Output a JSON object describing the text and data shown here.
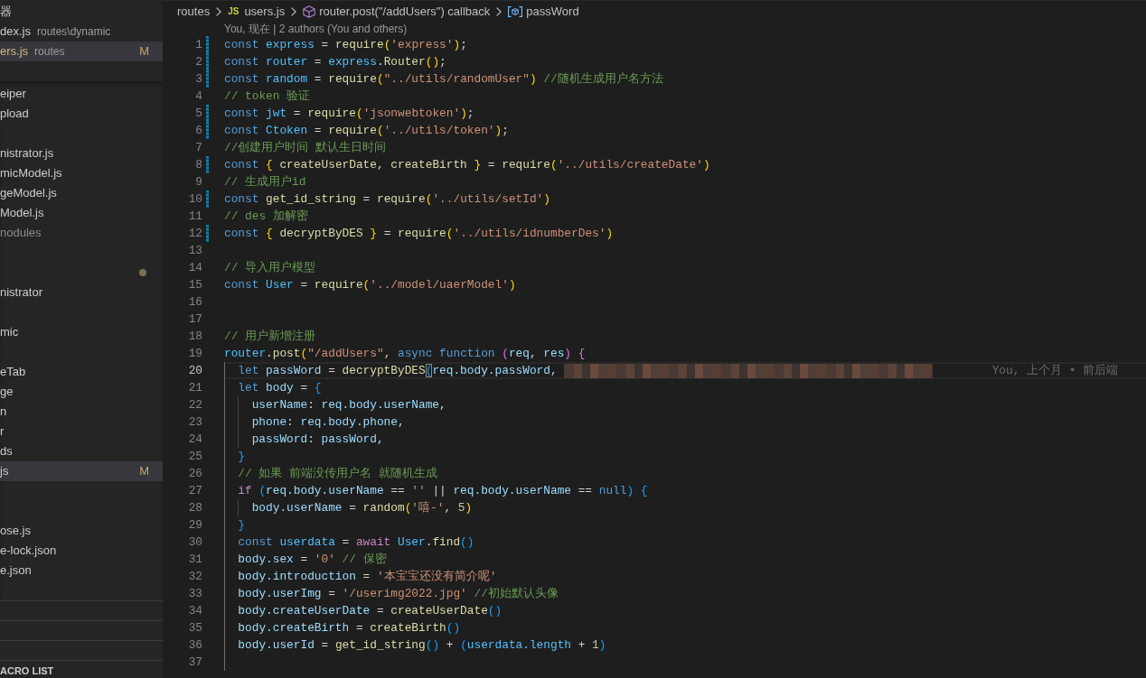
{
  "explorer": {
    "section_title": "器",
    "open_editors": [
      {
        "label": "dex.js",
        "description": "routes\\dynamic",
        "modified": false,
        "selected": false
      },
      {
        "label": "ers.js",
        "description": "routes",
        "badge": "M",
        "modified": true,
        "selected": true
      }
    ],
    "tree": [
      {
        "kind": "entry",
        "label": "eiper",
        "modified": false,
        "ignored": false,
        "selected": false
      },
      {
        "kind": "entry",
        "label": "pload",
        "modified": false,
        "ignored": false,
        "selected": false
      },
      {
        "kind": "entry",
        "label": "nistrator.js",
        "modified": false,
        "ignored": false,
        "selected": false
      },
      {
        "kind": "entry",
        "label": "micModel.js",
        "modified": false,
        "ignored": false,
        "selected": false
      },
      {
        "kind": "entry",
        "label": "geModel.js",
        "modified": false,
        "ignored": false,
        "selected": false
      },
      {
        "kind": "entry",
        "label": "Model.js",
        "modified": false,
        "ignored": false,
        "selected": false
      },
      {
        "kind": "entry",
        "label": "nodules",
        "modified": false,
        "ignored": true,
        "selected": false
      },
      {
        "kind": "dot",
        "modified": true,
        "ignored": false,
        "selected": false
      },
      {
        "kind": "entry",
        "label": "nistrator",
        "modified": false,
        "ignored": false,
        "selected": false
      },
      {
        "kind": "entry",
        "label": "mic",
        "modified": false,
        "ignored": false,
        "selected": false
      },
      {
        "kind": "entry",
        "label": "eTab",
        "modified": false,
        "ignored": false,
        "selected": false
      },
      {
        "kind": "entry",
        "label": "ge",
        "modified": false,
        "ignored": false,
        "selected": false
      },
      {
        "kind": "entry",
        "label": "n",
        "modified": false,
        "ignored": false,
        "selected": false
      },
      {
        "kind": "entry",
        "label": "r",
        "modified": false,
        "ignored": false,
        "selected": false
      },
      {
        "kind": "entry",
        "label": "ds",
        "modified": false,
        "ignored": false,
        "selected": false
      },
      {
        "kind": "entry",
        "label": "js",
        "badge": "M",
        "modified": false,
        "ignored": false,
        "selected": true
      },
      {
        "kind": "entry",
        "label": "ose.js",
        "modified": false,
        "ignored": false,
        "selected": false
      },
      {
        "kind": "entry",
        "label": "e-lock.json",
        "modified": false,
        "ignored": false,
        "selected": false
      },
      {
        "kind": "entry",
        "label": "e.json",
        "modified": false,
        "ignored": false,
        "selected": false
      }
    ],
    "bottom_panel_title": "ACRO LIST"
  },
  "editor": {
    "breadcrumb": [
      {
        "kind": "folder",
        "label": "routes"
      },
      {
        "kind": "file",
        "badge": "JS",
        "label": "users.js"
      },
      {
        "kind": "method",
        "label": "router.post(\"/addUsers\") callback"
      },
      {
        "kind": "variable",
        "label": "passWord"
      }
    ],
    "codelens": "You, 现在 | 2 authors (You and others)",
    "lines": [
      {
        "number": "1",
        "changed": true,
        "current": false,
        "tokens": [
          {
            "text": "const ",
            "kind": "keyword"
          },
          {
            "text": "express",
            "kind": "constant"
          },
          {
            "text": " = ",
            "kind": "plain"
          },
          {
            "text": "require",
            "kind": "function"
          },
          {
            "text": "(",
            "kind": "bracket1"
          },
          {
            "text": "'express'",
            "kind": "string"
          },
          {
            "text": ")",
            "kind": "bracket1"
          },
          {
            "text": ";",
            "kind": "plain"
          }
        ]
      },
      {
        "number": "2",
        "changed": true,
        "current": false,
        "tokens": [
          {
            "text": "const ",
            "kind": "keyword"
          },
          {
            "text": "router",
            "kind": "constant"
          },
          {
            "text": " = ",
            "kind": "plain"
          },
          {
            "text": "express",
            "kind": "constant"
          },
          {
            "text": ".",
            "kind": "plain"
          },
          {
            "text": "Router",
            "kind": "function"
          },
          {
            "text": "()",
            "kind": "bracket1"
          },
          {
            "text": ";",
            "kind": "plain"
          }
        ]
      },
      {
        "number": "3",
        "changed": true,
        "current": false,
        "tokens": [
          {
            "text": "const ",
            "kind": "keyword"
          },
          {
            "text": "random",
            "kind": "constant"
          },
          {
            "text": " = ",
            "kind": "plain"
          },
          {
            "text": "require",
            "kind": "function"
          },
          {
            "text": "(",
            "kind": "bracket1"
          },
          {
            "text": "\"../utils/randomUser\"",
            "kind": "string"
          },
          {
            "text": ")",
            "kind": "bracket1"
          },
          {
            "text": " //随机生成用户名方法",
            "kind": "comment"
          }
        ]
      },
      {
        "number": "4",
        "changed": false,
        "current": false,
        "tokens": [
          {
            "text": "// token 验证",
            "kind": "comment"
          }
        ]
      },
      {
        "number": "5",
        "changed": true,
        "current": false,
        "tokens": [
          {
            "text": "const ",
            "kind": "keyword"
          },
          {
            "text": "jwt",
            "kind": "constant"
          },
          {
            "text": " = ",
            "kind": "plain"
          },
          {
            "text": "require",
            "kind": "function"
          },
          {
            "text": "(",
            "kind": "bracket1"
          },
          {
            "text": "'jsonwebtoken'",
            "kind": "string"
          },
          {
            "text": ")",
            "kind": "bracket1"
          },
          {
            "text": ";",
            "kind": "plain"
          }
        ]
      },
      {
        "number": "6",
        "changed": true,
        "current": false,
        "tokens": [
          {
            "text": "const ",
            "kind": "keyword"
          },
          {
            "text": "Ctoken",
            "kind": "constant"
          },
          {
            "text": " = ",
            "kind": "plain"
          },
          {
            "text": "require",
            "kind": "function"
          },
          {
            "text": "(",
            "kind": "bracket1"
          },
          {
            "text": "'../utils/token'",
            "kind": "string"
          },
          {
            "text": ")",
            "kind": "bracket1"
          },
          {
            "text": ";",
            "kind": "plain"
          }
        ]
      },
      {
        "number": "7",
        "changed": false,
        "current": false,
        "tokens": [
          {
            "text": "//创建用户时间 默认生日时间",
            "kind": "comment"
          }
        ]
      },
      {
        "number": "8",
        "changed": true,
        "current": false,
        "tokens": [
          {
            "text": "const ",
            "kind": "keyword"
          },
          {
            "text": "{",
            "kind": "bracket1"
          },
          {
            "text": " createUserDate",
            "kind": "function"
          },
          {
            "text": ", ",
            "kind": "plain"
          },
          {
            "text": "createBirth ",
            "kind": "function"
          },
          {
            "text": "}",
            "kind": "bracket1"
          },
          {
            "text": " = ",
            "kind": "plain"
          },
          {
            "text": "require",
            "kind": "function"
          },
          {
            "text": "(",
            "kind": "bracket1"
          },
          {
            "text": "'../utils/createDate'",
            "kind": "string"
          },
          {
            "text": ")",
            "kind": "bracket1"
          }
        ]
      },
      {
        "number": "9",
        "changed": false,
        "current": false,
        "tokens": [
          {
            "text": "// 生成用户id",
            "kind": "comment"
          }
        ]
      },
      {
        "number": "10",
        "changed": true,
        "current": false,
        "tokens": [
          {
            "text": "const ",
            "kind": "keyword"
          },
          {
            "text": "get_id_string",
            "kind": "function"
          },
          {
            "text": " = ",
            "kind": "plain"
          },
          {
            "text": "require",
            "kind": "function"
          },
          {
            "text": "(",
            "kind": "bracket1"
          },
          {
            "text": "'../utils/setId'",
            "kind": "string"
          },
          {
            "text": ")",
            "kind": "bracket1"
          }
        ]
      },
      {
        "number": "11",
        "changed": false,
        "current": false,
        "tokens": [
          {
            "text": "// des 加解密",
            "kind": "comment"
          }
        ]
      },
      {
        "number": "12",
        "changed": true,
        "current": false,
        "tokens": [
          {
            "text": "const ",
            "kind": "keyword"
          },
          {
            "text": "{",
            "kind": "bracket1"
          },
          {
            "text": " decryptByDES ",
            "kind": "function"
          },
          {
            "text": "}",
            "kind": "bracket1"
          },
          {
            "text": " = ",
            "kind": "plain"
          },
          {
            "text": "require",
            "kind": "function"
          },
          {
            "text": "(",
            "kind": "bracket1"
          },
          {
            "text": "'../utils/idnumberDes'",
            "kind": "string"
          },
          {
            "text": ")",
            "kind": "bracket1"
          }
        ]
      },
      {
        "number": "13",
        "changed": false,
        "current": false
      },
      {
        "number": "14",
        "changed": false,
        "current": false,
        "tokens": [
          {
            "text": "// 导入用户模型",
            "kind": "comment"
          }
        ]
      },
      {
        "number": "15",
        "changed": false,
        "current": false,
        "tokens": [
          {
            "text": "const ",
            "kind": "keyword"
          },
          {
            "text": "User",
            "kind": "constant"
          },
          {
            "text": " = ",
            "kind": "plain"
          },
          {
            "text": "require",
            "kind": "function"
          },
          {
            "text": "(",
            "kind": "bracket1"
          },
          {
            "text": "'../model/uaerModel'",
            "kind": "string"
          },
          {
            "text": ")",
            "kind": "bracket1"
          }
        ]
      },
      {
        "number": "16",
        "changed": false,
        "current": false
      },
      {
        "number": "17",
        "changed": false,
        "current": false
      },
      {
        "number": "18",
        "changed": false,
        "current": false,
        "tokens": [
          {
            "text": "// 用户新增注册",
            "kind": "comment"
          }
        ]
      },
      {
        "number": "19",
        "changed": false,
        "current": false,
        "tokens": [
          {
            "text": "router",
            "kind": "constant"
          },
          {
            "text": ".",
            "kind": "plain"
          },
          {
            "text": "post",
            "kind": "function"
          },
          {
            "text": "(",
            "kind": "bracket1"
          },
          {
            "text": "\"/addUsers\"",
            "kind": "string"
          },
          {
            "text": ", ",
            "kind": "plain"
          },
          {
            "text": "async function ",
            "kind": "keyword"
          },
          {
            "text": "(",
            "kind": "bracket2"
          },
          {
            "text": "req",
            "kind": "variable"
          },
          {
            "text": ", ",
            "kind": "plain"
          },
          {
            "text": "res",
            "kind": "variable"
          },
          {
            "text": ") {",
            "kind": "bracket2"
          }
        ]
      },
      {
        "number": "20",
        "changed": false,
        "current": true,
        "blame": "You, 上个月 • 前后端",
        "tokens": [
          {
            "text": "  let ",
            "kind": "keyword"
          },
          {
            "text": "passWord",
            "kind": "variable"
          },
          {
            "text": " = ",
            "kind": "plain"
          },
          {
            "text": "decryptByDES",
            "kind": "function"
          },
          {
            "text": "(",
            "kind": "bracket-match"
          },
          {
            "text": "req.body.passWord",
            "kind": "variable"
          },
          {
            "text": ",",
            "kind": "plain"
          },
          {
            "kind": "redacted"
          }
        ]
      },
      {
        "number": "21",
        "changed": false,
        "current": false,
        "tokens": [
          {
            "text": "  let ",
            "kind": "keyword"
          },
          {
            "text": "body",
            "kind": "variable"
          },
          {
            "text": " = ",
            "kind": "plain"
          },
          {
            "text": "{",
            "kind": "bracket3"
          }
        ]
      },
      {
        "number": "22",
        "changed": false,
        "current": false,
        "tokens": [
          {
            "text": "    userName",
            "kind": "variable"
          },
          {
            "text": ": ",
            "kind": "plain"
          },
          {
            "text": "req.body.userName",
            "kind": "variable"
          },
          {
            "text": ",",
            "kind": "plain"
          }
        ]
      },
      {
        "number": "23",
        "changed": false,
        "current": false,
        "tokens": [
          {
            "text": "    phone",
            "kind": "variable"
          },
          {
            "text": ": ",
            "kind": "plain"
          },
          {
            "text": "req.body.phone",
            "kind": "variable"
          },
          {
            "text": ",",
            "kind": "plain"
          }
        ]
      },
      {
        "number": "24",
        "changed": false,
        "current": false,
        "tokens": [
          {
            "text": "    passWord",
            "kind": "variable"
          },
          {
            "text": ": ",
            "kind": "plain"
          },
          {
            "text": "passWord",
            "kind": "variable"
          },
          {
            "text": ",",
            "kind": "plain"
          }
        ]
      },
      {
        "number": "25",
        "changed": false,
        "current": false,
        "tokens": [
          {
            "text": "  }",
            "kind": "bracket3"
          }
        ]
      },
      {
        "number": "26",
        "changed": false,
        "current": false,
        "tokens": [
          {
            "text": "  // 如果 前端没传用户名 就随机生成",
            "kind": "comment"
          }
        ]
      },
      {
        "number": "27",
        "changed": false,
        "current": false,
        "tokens": [
          {
            "text": "  if ",
            "kind": "control"
          },
          {
            "text": "(",
            "kind": "bracket3"
          },
          {
            "text": "req.body.userName",
            "kind": "variable"
          },
          {
            "text": " == ",
            "kind": "plain"
          },
          {
            "text": "''",
            "kind": "string"
          },
          {
            "text": " || ",
            "kind": "plain"
          },
          {
            "text": "req.body.userName",
            "kind": "variable"
          },
          {
            "text": " == ",
            "kind": "plain"
          },
          {
            "text": "null",
            "kind": "keyword"
          },
          {
            "text": ") {",
            "kind": "bracket3"
          }
        ]
      },
      {
        "number": "28",
        "changed": false,
        "current": false,
        "tokens": [
          {
            "text": "    body.userName",
            "kind": "variable"
          },
          {
            "text": " = ",
            "kind": "plain"
          },
          {
            "text": "random",
            "kind": "function"
          },
          {
            "text": "(",
            "kind": "bracket1"
          },
          {
            "text": "'嘻-'",
            "kind": "string"
          },
          {
            "text": ", ",
            "kind": "plain"
          },
          {
            "text": "5",
            "kind": "number"
          },
          {
            "text": ")",
            "kind": "bracket1"
          }
        ]
      },
      {
        "number": "29",
        "changed": false,
        "current": false,
        "tokens": [
          {
            "text": "  }",
            "kind": "bracket3"
          }
        ]
      },
      {
        "number": "30",
        "changed": false,
        "current": false,
        "tokens": [
          {
            "text": "  const ",
            "kind": "keyword"
          },
          {
            "text": "userdata",
            "kind": "constant"
          },
          {
            "text": " = ",
            "kind": "plain"
          },
          {
            "text": "await ",
            "kind": "control"
          },
          {
            "text": "User",
            "kind": "constant"
          },
          {
            "text": ".",
            "kind": "plain"
          },
          {
            "text": "find",
            "kind": "function"
          },
          {
            "text": "()",
            "kind": "bracket3"
          }
        ]
      },
      {
        "number": "31",
        "changed": false,
        "current": false,
        "tokens": [
          {
            "text": "  body.sex",
            "kind": "variable"
          },
          {
            "text": " = ",
            "kind": "plain"
          },
          {
            "text": "'0'",
            "kind": "string"
          },
          {
            "text": " // 保密",
            "kind": "comment"
          }
        ]
      },
      {
        "number": "32",
        "changed": false,
        "current": false,
        "tokens": [
          {
            "text": "  body.introduction",
            "kind": "variable"
          },
          {
            "text": " = ",
            "kind": "plain"
          },
          {
            "text": "'本宝宝还没有简介呢'",
            "kind": "string"
          }
        ]
      },
      {
        "number": "33",
        "changed": false,
        "current": false,
        "tokens": [
          {
            "text": "  body.userImg",
            "kind": "variable"
          },
          {
            "text": " = ",
            "kind": "plain"
          },
          {
            "text": "'/userimg2022.jpg'",
            "kind": "string"
          },
          {
            "text": " //初始默认头像",
            "kind": "comment"
          }
        ]
      },
      {
        "number": "34",
        "changed": false,
        "current": false,
        "tokens": [
          {
            "text": "  body.createUserDate",
            "kind": "variable"
          },
          {
            "text": " = ",
            "kind": "plain"
          },
          {
            "text": "createUserDate",
            "kind": "function"
          },
          {
            "text": "()",
            "kind": "bracket3"
          }
        ]
      },
      {
        "number": "35",
        "changed": false,
        "current": false,
        "tokens": [
          {
            "text": "  body.createBirth",
            "kind": "variable"
          },
          {
            "text": " = ",
            "kind": "plain"
          },
          {
            "text": "createBirth",
            "kind": "function"
          },
          {
            "text": "()",
            "kind": "bracket3"
          }
        ]
      },
      {
        "number": "36",
        "changed": false,
        "current": false,
        "tokens": [
          {
            "text": "  body.userId",
            "kind": "variable"
          },
          {
            "text": " = ",
            "kind": "plain"
          },
          {
            "text": "get_id_string",
            "kind": "function"
          },
          {
            "text": "()",
            "kind": "bracket3"
          },
          {
            "text": " + ",
            "kind": "plain"
          },
          {
            "text": "(",
            "kind": "bracket3"
          },
          {
            "text": "userdata.length",
            "kind": "constant"
          },
          {
            "text": " + ",
            "kind": "plain"
          },
          {
            "text": "1",
            "kind": "number"
          },
          {
            "text": ")",
            "kind": "bracket3"
          }
        ]
      },
      {
        "number": "37",
        "changed": false,
        "current": false
      }
    ]
  }
}
